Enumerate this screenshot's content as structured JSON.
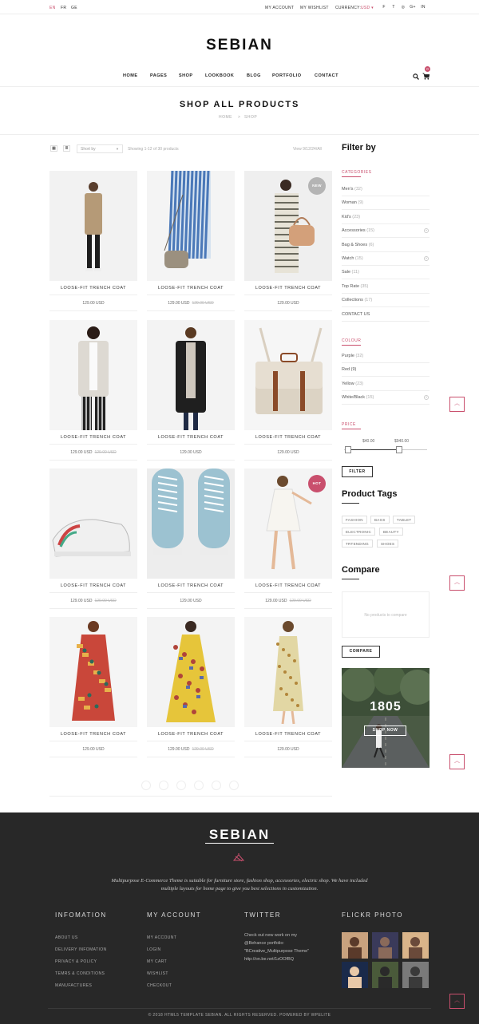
{
  "topbar": {
    "languages": [
      "EN",
      "FR",
      "GE"
    ],
    "my_account": "MY ACCOUNT",
    "my_wishlist": "MY WISHLIST",
    "currency_label": "CURRENCY:",
    "currency_value": "USD",
    "social_icons": [
      "facebook-icon",
      "twitter-icon",
      "dribbble-icon",
      "google-plus-icon",
      "linkedin-icon"
    ],
    "social_glyphs": [
      "f",
      "t",
      "◎",
      "g+",
      "in"
    ]
  },
  "brand": {
    "logo": "SEBIAN",
    "accent_color": "#c94f6d"
  },
  "nav": {
    "items": [
      "HOME",
      "PAGES",
      "SHOP",
      "LOOKBOOK",
      "BLOG",
      "PORTFOLIO",
      "CONTACT"
    ],
    "cart_count": "0"
  },
  "page": {
    "title": "SHOP ALL PRODUCTS",
    "breadcrumb_home": "HOME",
    "breadcrumb_sep": ">",
    "breadcrumb_current": "SHOP"
  },
  "toolbar": {
    "sort_placeholder": "Short by",
    "showing": "Showing 1-12 of 30 products",
    "view": "View 9/12/24/All"
  },
  "products": [
    {
      "name": "LOOSE-FIT TRENCH COAT",
      "price": "129.00 USD",
      "old_price": "",
      "badge": ""
    },
    {
      "name": "LOOSE-FIT TRENCH COAT",
      "price": "129.00 USD",
      "old_price": "129.00 USD",
      "badge": ""
    },
    {
      "name": "LOOSE-FIT TRENCH COAT",
      "price": "129.00 USD",
      "old_price": "",
      "badge": "NEW"
    },
    {
      "name": "LOOSE-FIT TRENCH COAT",
      "price": "129.00 USD",
      "old_price": "129.00 USD",
      "badge": ""
    },
    {
      "name": "LOOSE-FIT TRENCH COAT",
      "price": "129.00 USD",
      "old_price": "",
      "badge": ""
    },
    {
      "name": "LOOSE-FIT TRENCH COAT",
      "price": "129.00 USD",
      "old_price": "",
      "badge": ""
    },
    {
      "name": "LOOSE-FIT TRENCH COAT",
      "price": "129.00 USD",
      "old_price": "129.00 USD",
      "badge": ""
    },
    {
      "name": "LOOSE-FIT TRENCH COAT",
      "price": "129.00 USD",
      "old_price": "",
      "badge": ""
    },
    {
      "name": "LOOSE-FIT TRENCH COAT",
      "price": "129.00 USD",
      "old_price": "129.00 USD",
      "badge": "HOT"
    },
    {
      "name": "LOOSE-FIT TRENCH COAT",
      "price": "129.00 USD",
      "old_price": "",
      "badge": ""
    },
    {
      "name": "LOOSE-FIT TRENCH COAT",
      "price": "129.00 USD",
      "old_price": "129.00 USD",
      "badge": ""
    },
    {
      "name": "LOOSE-FIT TRENCH COAT",
      "price": "129.00 USD",
      "old_price": "",
      "badge": ""
    }
  ],
  "sidebar": {
    "filter_title": "Filter by",
    "categories_label": "CATEGORIES",
    "categories": [
      {
        "name": "Men's",
        "count": "(32)"
      },
      {
        "name": "Woman",
        "count": "(9)"
      },
      {
        "name": "Kid's",
        "count": "(23)"
      },
      {
        "name": "Accessories",
        "count": "(15)"
      },
      {
        "name": "Bag & Shoes",
        "count": "(6)"
      },
      {
        "name": "Watch",
        "count": "(15)"
      },
      {
        "name": "Sale",
        "count": "(11)"
      },
      {
        "name": "Top Rate",
        "count": "(35)"
      },
      {
        "name": "Collections",
        "count": "(17)"
      },
      {
        "name": "CONTACT US",
        "count": ""
      }
    ],
    "colour_label": "COLOUR",
    "colours": [
      {
        "name": "Purple",
        "count": "(32)"
      },
      {
        "name": "Red (9)",
        "count": "(9)"
      },
      {
        "name": "Yellow",
        "count": "(23)"
      },
      {
        "name": "White/Black",
        "count": "(15)"
      }
    ],
    "price_label": "PRICE",
    "price_min": "$40.00",
    "price_max": "$940.00",
    "filter_button": "FILTER",
    "tags_title": "Product Tags",
    "tags": [
      "FASHION",
      "BAGS",
      "TABLET",
      "ELECTRONIC",
      "BEAUTY",
      "TRTENDING",
      "SHOES"
    ],
    "compare_title": "Compare",
    "compare_empty": "No products to compare",
    "compare_button": "COMPARE",
    "promo_year": "1805",
    "promo_button": "SHOP NOW"
  },
  "footer": {
    "logo": "SEBIAN",
    "description_line1": "Multipurpose E-Commerce Theme is suitable for furniture store, fashion shop, accessories, electric shop. We have included",
    "description_line2": "multiple layouts for home page to give you best selections in customization.",
    "info_title": "INFOMATION",
    "info_links": [
      "ABOUT US",
      "DELIVERY INFOMATION",
      "PRIVACY & POLICY",
      "TEMRS & CONDITIONS",
      "MANUFACTURES"
    ],
    "account_title": "MY ACCOUNT",
    "account_links": [
      "MY ACCOUNT",
      "LOGIN",
      "MY CART",
      "WISHLIST",
      "CHECKOUT"
    ],
    "twitter_title": "TWITTER",
    "twitter_lines": [
      "Check out new work on my",
      "@Behance portfolio:",
      "\"BCreative_Multipurpose Theme\"",
      "http://on.be.net/1zOOfBQ"
    ],
    "flickr_title": "FLICKR PHOTO",
    "copyright": "© 2018 HTML5 TEMPLATE SEBIAN. ALL RIGHTS RESERVED. POWERED BY WPELITE"
  }
}
